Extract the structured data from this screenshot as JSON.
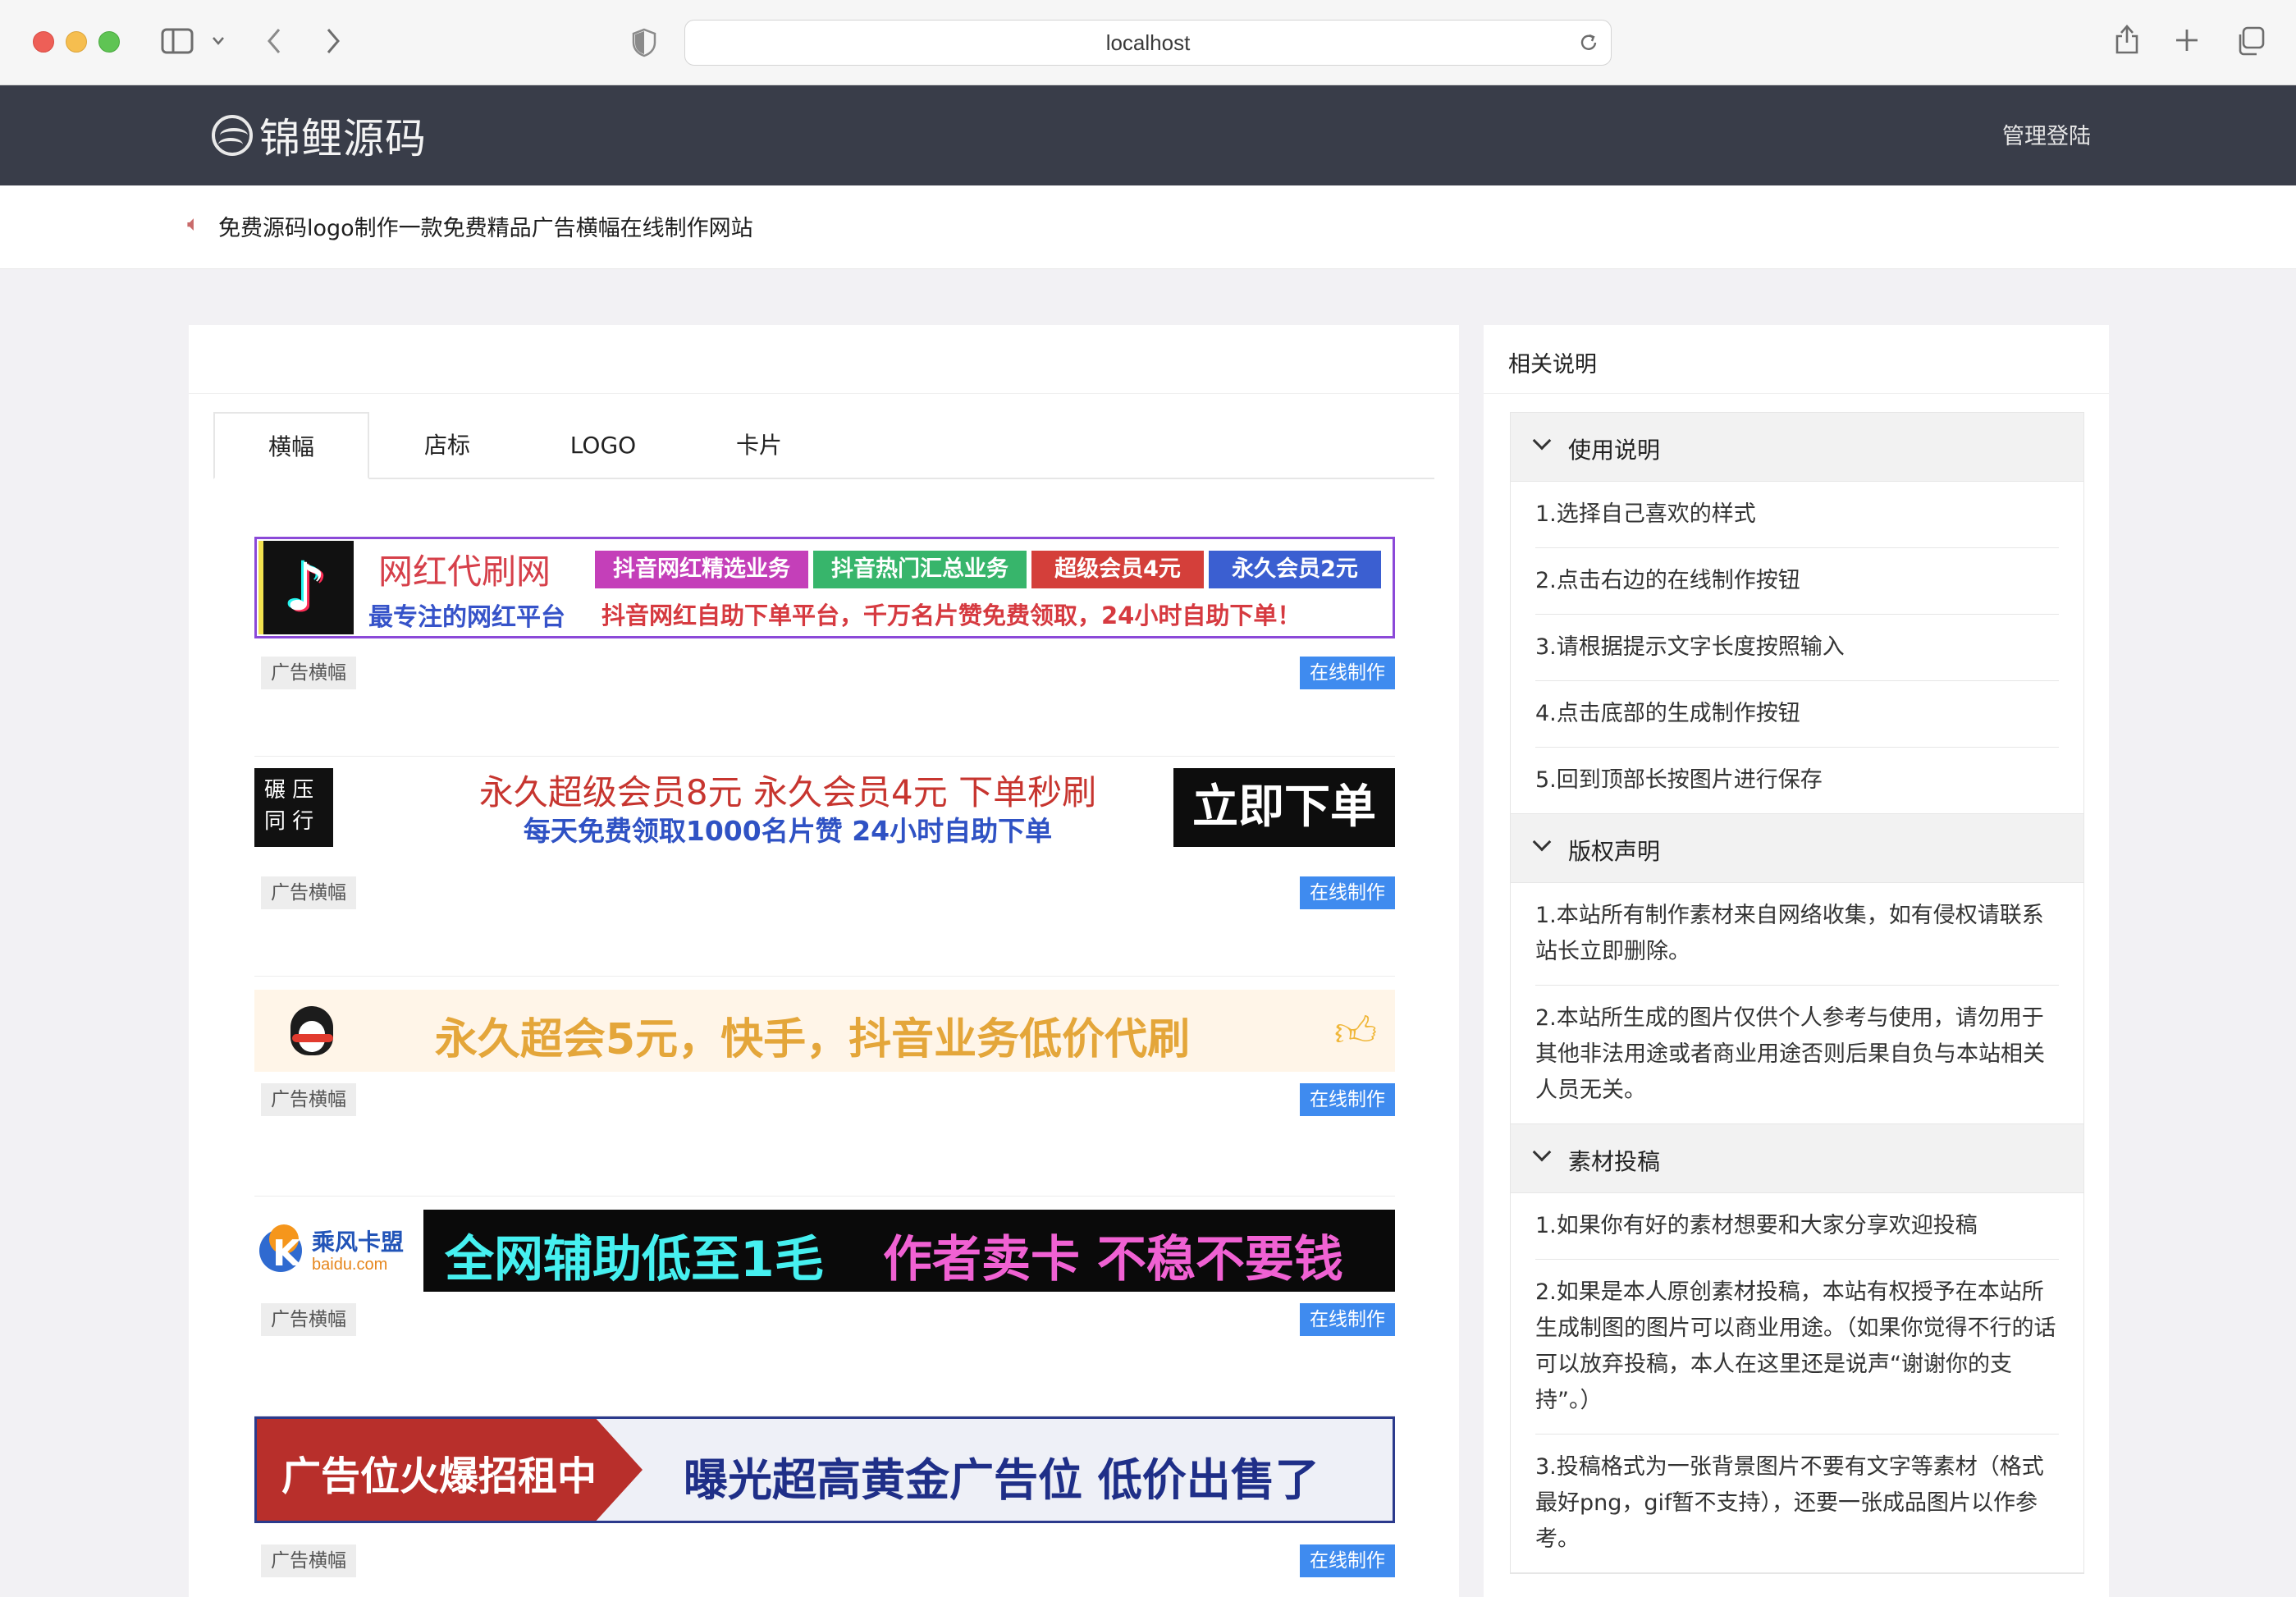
{
  "browser": {
    "url": "localhost"
  },
  "header": {
    "logo_text": "锦鲤源码",
    "admin_login": "管理登陆"
  },
  "notice": {
    "text": "免费源码logo制作一款免费精品广告横幅在线制作网站"
  },
  "tabs": [
    "横幅",
    "店标",
    "LOGO",
    "卡片"
  ],
  "banners": {
    "tag_label": "广告横幅",
    "make_label": "在线制作",
    "b1": {
      "title": "网红代刷网",
      "subtitle": "最专注的网红平台",
      "pills": [
        "抖音网红精选业务",
        "抖音热门汇总业务",
        "超级会员4元",
        "永久会员2元"
      ],
      "tail": "抖音网红自助下单平台，千万名片赞免费领取，24小时自助下单！"
    },
    "b2": {
      "stamp": "碾 压 同 行",
      "line1": "永久超级会员8元  永久会员4元  下单秒刷",
      "line2": "每天免费领取1000名片赞  24小时自助下单",
      "cta": "立即下单"
    },
    "b3": {
      "text": "永久超会5元，快手，抖音业务低价代刷"
    },
    "b4": {
      "brand": "乘风卡盟",
      "domain": "baidu.com",
      "slogan1": "全网辅助低至1毛",
      "slogan2": "作者卖卡 不稳不要钱"
    },
    "b5": {
      "left": "广告位火爆招租中",
      "right": "曝光超高黄金广告位 低价出售了"
    }
  },
  "side": {
    "title": "相关说明",
    "sections": [
      {
        "title": "使用说明",
        "items": [
          "1.选择自己喜欢的样式",
          "2.点击右边的在线制作按钮",
          "3.请根据提示文字长度按照输入",
          "4.点击底部的生成制作按钮",
          "5.回到顶部长按图片进行保存"
        ]
      },
      {
        "title": "版权声明",
        "items": [
          "1.本站所有制作素材来自网络收集，如有侵权请联系站长立即删除。",
          "2.本站所生成的图片仅供个人参考与使用，请勿用于其他非法用途或者商业用途否则后果自负与本站相关人员无关。"
        ]
      },
      {
        "title": "素材投稿",
        "items": [
          "1.如果你有好的素材想要和大家分享欢迎投稿",
          "2.如果是本人原创素材投稿，本站有权授予在本站所生成制图的图片可以商业用途。（如果你觉得不行的话可以放弃投稿，本人在这里还是说声“谢谢你的支持”。）",
          "3.投稿格式为一张背景图片不要有文字等素材（格式最好png，gif暂不支持），还要一张成品图片以作参考。"
        ]
      }
    ]
  }
}
